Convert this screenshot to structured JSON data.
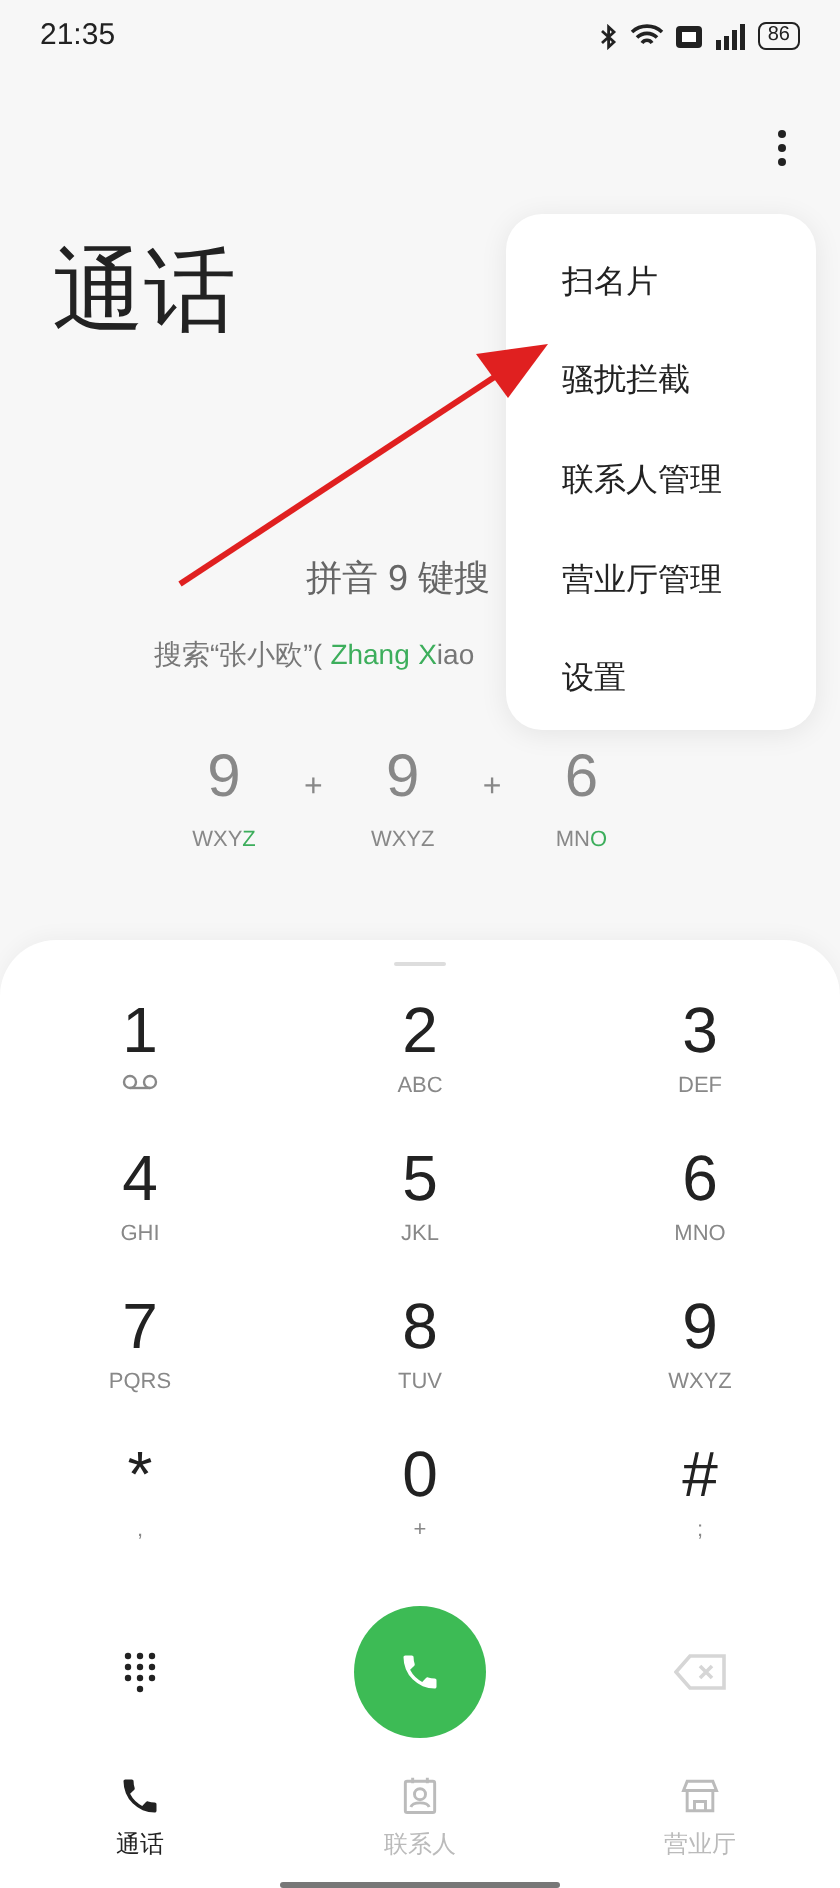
{
  "status_bar": {
    "time": "21:35",
    "battery": "86"
  },
  "title": "通话",
  "hint": "拼音 9 键搜",
  "example": [
    {
      "text": "搜索“张小欧”(",
      "highlight": false
    },
    {
      "text": "Zhang",
      "highlight": true,
      "gap": true
    },
    {
      "text": "X",
      "highlight": true,
      "gap": true
    },
    {
      "text": "iao",
      "highlight": false,
      "gap": false
    }
  ],
  "example_keys": [
    {
      "digit": "9",
      "letters": [
        {
          "text": "WXY",
          "highlight": false
        },
        {
          "text": "Z",
          "highlight": true
        }
      ]
    },
    {
      "digit": "9",
      "separator": "+",
      "letters": [
        {
          "text": "WXYZ",
          "highlight": false
        }
      ]
    },
    {
      "digit": "6",
      "separator": "+",
      "letters": [
        {
          "text": "MN",
          "highlight": false
        },
        {
          "text": "O",
          "highlight": true
        }
      ]
    }
  ],
  "menu": [
    "扫名片",
    "骚扰拦截",
    "联系人管理",
    "营业厅管理",
    "设置"
  ],
  "keys": [
    {
      "digit": "1",
      "kind": "voicemail"
    },
    {
      "digit": "2",
      "sub": "ABC",
      "kind": "text"
    },
    {
      "digit": "3",
      "sub": "DEF",
      "kind": "text"
    },
    {
      "digit": "4",
      "sub": "GHI",
      "kind": "text"
    },
    {
      "digit": "5",
      "sub": "JKL",
      "kind": "text"
    },
    {
      "digit": "6",
      "sub": "MNO",
      "kind": "text"
    },
    {
      "digit": "7",
      "sub": "PQRS",
      "kind": "text"
    },
    {
      "digit": "8",
      "sub": "TUV",
      "kind": "text"
    },
    {
      "digit": "9",
      "sub": "WXYZ",
      "kind": "text"
    },
    {
      "digit": "*",
      "sub": ",",
      "kind": "text"
    },
    {
      "digit": "0",
      "sub": "+",
      "kind": "text"
    },
    {
      "digit": "#",
      "sub": ";",
      "kind": "text"
    }
  ],
  "backspace": {
    "disabled": true
  },
  "tabs": [
    {
      "label": "通话",
      "selected": true,
      "kind": "phone"
    },
    {
      "label": "联系人",
      "selected": false,
      "kind": "contacts"
    },
    {
      "label": "营业厅",
      "selected": false,
      "kind": "store"
    }
  ]
}
